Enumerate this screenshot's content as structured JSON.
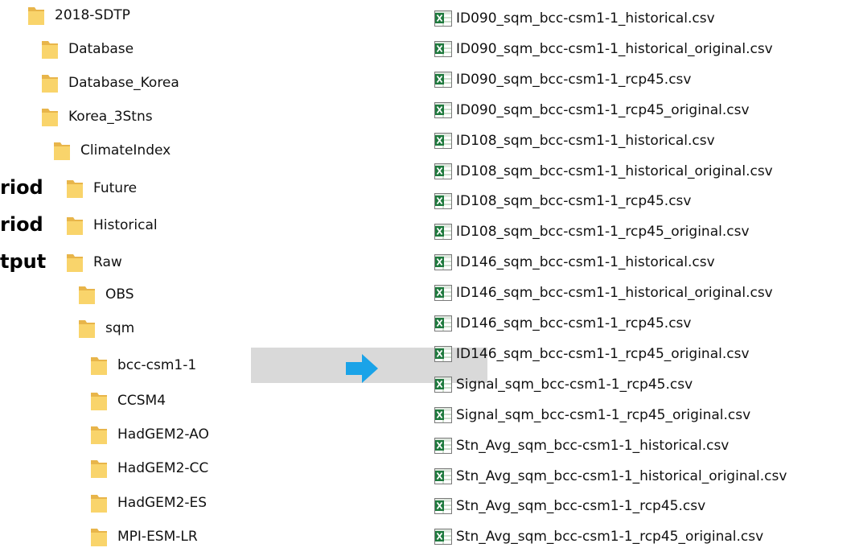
{
  "left_labels": {
    "future_period": "riod",
    "historical_period": "riod",
    "raw_output": "tput"
  },
  "tree": {
    "selected": "bcc-csm1-1",
    "items": [
      {
        "label": "2018-SDTP"
      },
      {
        "label": "Database"
      },
      {
        "label": "Database_Korea"
      },
      {
        "label": "Korea_3Stns"
      },
      {
        "label": "ClimateIndex"
      },
      {
        "label": "Future"
      },
      {
        "label": "Historical"
      },
      {
        "label": "Raw"
      },
      {
        "label": "OBS"
      },
      {
        "label": "sqm"
      },
      {
        "label": "bcc-csm1-1"
      },
      {
        "label": "CCSM4"
      },
      {
        "label": "HadGEM2-AO"
      },
      {
        "label": "HadGEM2-CC"
      },
      {
        "label": "HadGEM2-ES"
      },
      {
        "label": "MPI-ESM-LR"
      }
    ]
  },
  "files": [
    {
      "name": "ID090_sqm_bcc-csm1-1_historical.csv"
    },
    {
      "name": "ID090_sqm_bcc-csm1-1_historical_original.csv"
    },
    {
      "name": "ID090_sqm_bcc-csm1-1_rcp45.csv"
    },
    {
      "name": "ID090_sqm_bcc-csm1-1_rcp45_original.csv"
    },
    {
      "name": "ID108_sqm_bcc-csm1-1_historical.csv"
    },
    {
      "name": "ID108_sqm_bcc-csm1-1_historical_original.csv"
    },
    {
      "name": "ID108_sqm_bcc-csm1-1_rcp45.csv"
    },
    {
      "name": "ID108_sqm_bcc-csm1-1_rcp45_original.csv"
    },
    {
      "name": "ID146_sqm_bcc-csm1-1_historical.csv"
    },
    {
      "name": "ID146_sqm_bcc-csm1-1_historical_original.csv"
    },
    {
      "name": "ID146_sqm_bcc-csm1-1_rcp45.csv"
    },
    {
      "name": "ID146_sqm_bcc-csm1-1_rcp45_original.csv"
    },
    {
      "name": "Signal_sqm_bcc-csm1-1_rcp45.csv"
    },
    {
      "name": "Signal_sqm_bcc-csm1-1_rcp45_original.csv"
    },
    {
      "name": "Stn_Avg_sqm_bcc-csm1-1_historical.csv"
    },
    {
      "name": "Stn_Avg_sqm_bcc-csm1-1_historical_original.csv"
    },
    {
      "name": "Stn_Avg_sqm_bcc-csm1-1_rcp45.csv"
    },
    {
      "name": "Stn_Avg_sqm_bcc-csm1-1_rcp45_original.csv"
    }
  ],
  "icons": {
    "folder": "folder-icon",
    "csv": "excel-csv-icon",
    "arrow": "arrow-right-icon"
  },
  "colors": {
    "selection": "#d9d9d9",
    "folder_back": "#e8b54a",
    "folder_front": "#f9d46b",
    "arrow": "#1aa3e8",
    "excel_green": "#1f7a3e"
  }
}
